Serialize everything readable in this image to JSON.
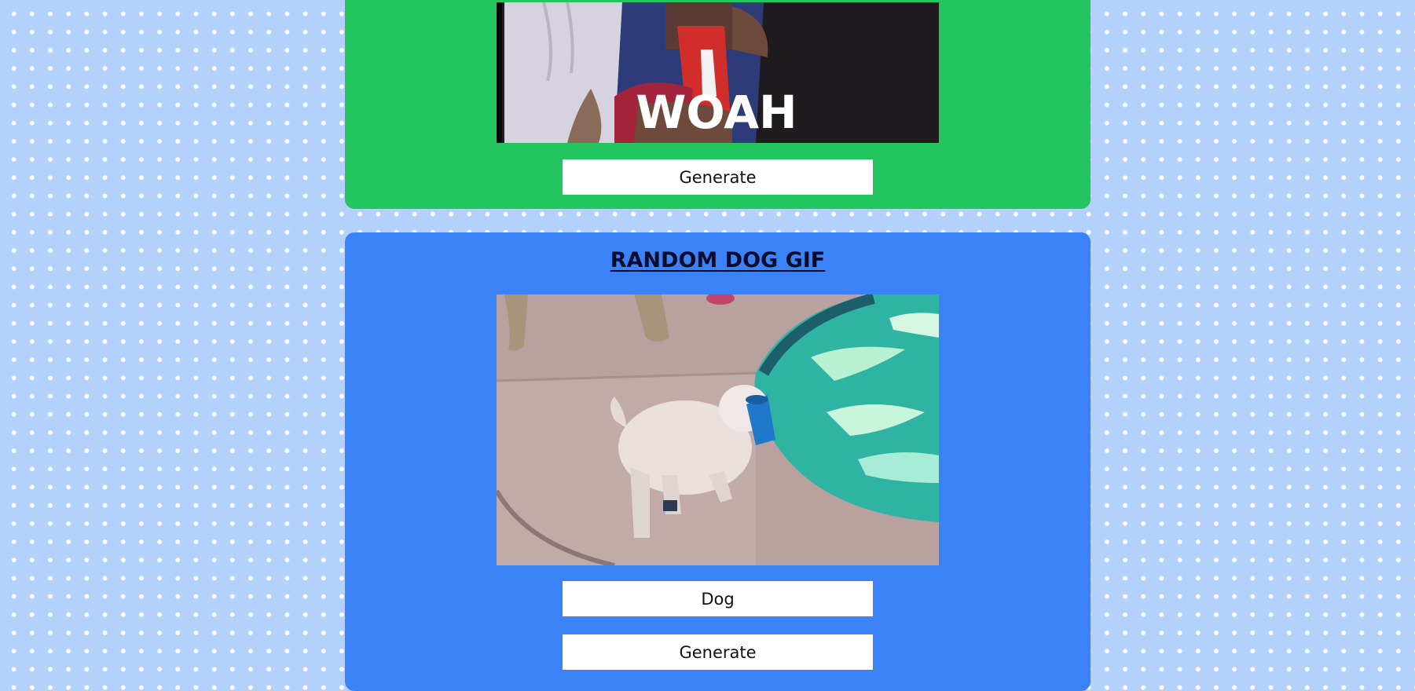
{
  "top_card": {
    "gif_caption": "WOAH",
    "generate_label": "Generate",
    "background_color": "#22c55e"
  },
  "dog_card": {
    "title": "RANDOM DOG GIF",
    "search_value": "Dog",
    "generate_label": "Generate",
    "background_color": "#3b82f6"
  },
  "page": {
    "background_color": "#b3d1fb",
    "dot_color": "#ffffff"
  }
}
